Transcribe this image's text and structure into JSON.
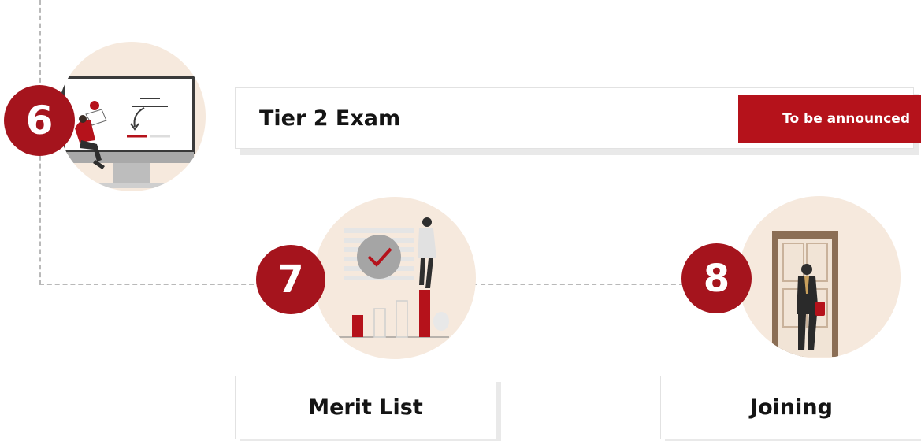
{
  "colors": {
    "accent": "#a5141d",
    "circle_bg": "#f6e9dd",
    "connector": "#b9b9b9"
  },
  "steps": [
    {
      "number": "6",
      "title": "Tier 2 Exam",
      "status": "To be announced",
      "illustration": "online-exam-illustration"
    },
    {
      "number": "7",
      "title": "Merit List",
      "illustration": "merit-list-illustration"
    },
    {
      "number": "8",
      "title": "Joining",
      "illustration": "joining-door-illustration"
    }
  ]
}
